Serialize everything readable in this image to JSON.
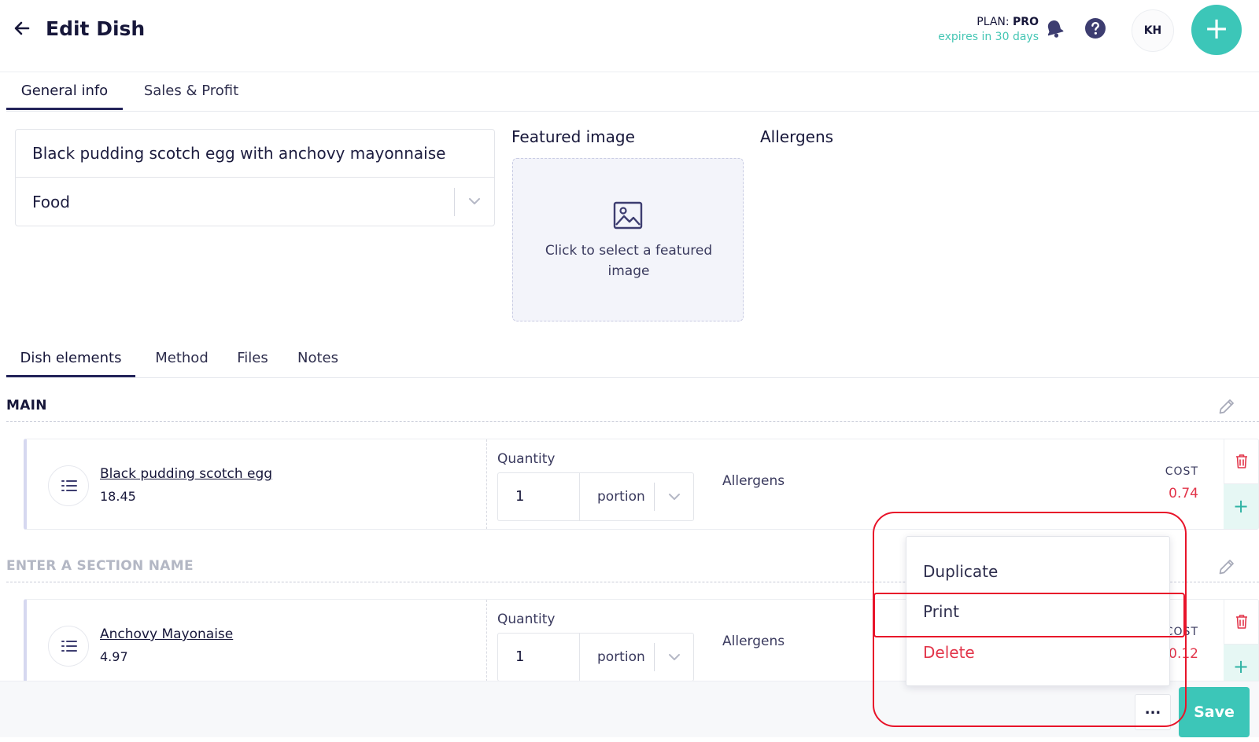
{
  "header": {
    "title": "Edit Dish",
    "plan_prefix": "PLAN:",
    "plan_name": "PRO",
    "plan_expires": "expires in 30 days",
    "avatar_initials": "KH",
    "fab_symbol": "+"
  },
  "tabs_top": [
    {
      "label": "General info",
      "active": true
    },
    {
      "label": "Sales & Profit",
      "active": false
    }
  ],
  "general": {
    "dish_name": "Black pudding scotch egg with anchovy mayonnaise",
    "category": "Food",
    "featured_title": "Featured image",
    "featured_placeholder": "Click to select a featured image",
    "allergens_title": "Allergens"
  },
  "tabs_mid": [
    {
      "label": "Dish elements",
      "active": true
    },
    {
      "label": "Method",
      "active": false
    },
    {
      "label": "Files",
      "active": false
    },
    {
      "label": "Notes",
      "active": false
    }
  ],
  "sections": [
    {
      "title": "MAIN",
      "title_color": "#17173a",
      "item": {
        "name": "Black pudding scotch egg",
        "price": "18.45",
        "quantity_label": "Quantity",
        "quantity": "1",
        "unit": "portion",
        "allergens_label": "Allergens",
        "cost_label": "COST",
        "cost": "0.74"
      }
    },
    {
      "title": "ENTER A SECTION NAME",
      "title_color": "#b3b7c4",
      "item": {
        "name": "Anchovy Mayonaise",
        "price": "4.97",
        "quantity_label": "Quantity",
        "quantity": "1",
        "unit": "portion",
        "allergens_label": "Allergens",
        "cost_label": "COST",
        "cost": "0.12"
      }
    }
  ],
  "footer": {
    "more_label": "...",
    "save_label": "Save"
  },
  "context_menu": {
    "items": [
      {
        "label": "Duplicate"
      },
      {
        "label": "Print"
      },
      {
        "label": "Delete"
      }
    ]
  },
  "colors": {
    "accent": "#3cc6b8",
    "danger": "#e2354a",
    "highlight": "#e8142a",
    "navy": "#17173a"
  }
}
